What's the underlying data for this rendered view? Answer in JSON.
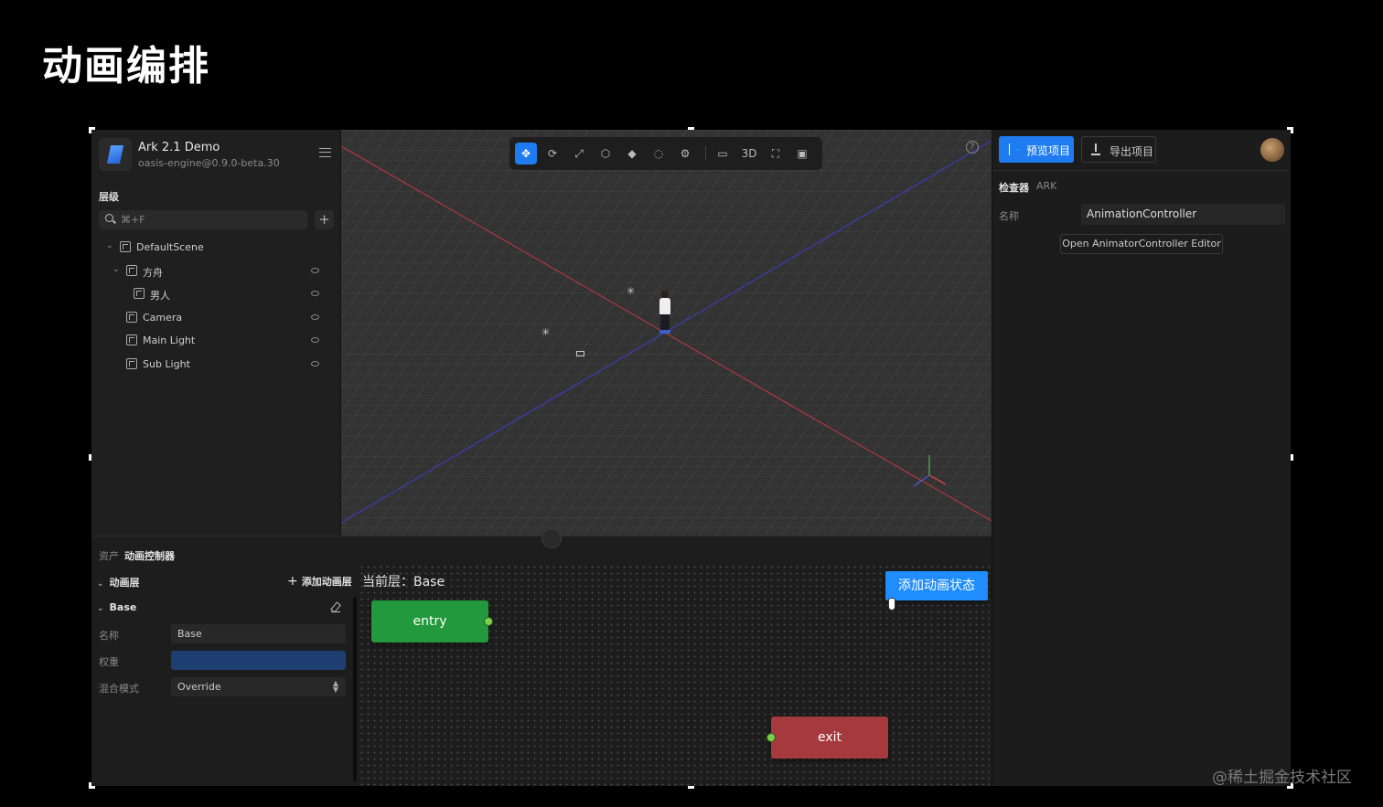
{
  "slide": {
    "title": "动画编排"
  },
  "app": {
    "name": "Ark 2.1 Demo",
    "version": "oasis-engine@0.9.0-beta.30"
  },
  "hierarchy": {
    "label": "层级",
    "search_placeholder": "⌘+F",
    "nodes": [
      {
        "label": "DefaultScene"
      },
      {
        "label": "方舟"
      },
      {
        "label": "男人"
      },
      {
        "label": "Camera"
      },
      {
        "label": "Main Light"
      },
      {
        "label": "Sub Light"
      }
    ]
  },
  "viewport": {
    "tools": [
      "move",
      "rotate",
      "scale",
      "mesh",
      "box",
      "circle",
      "settings",
      "camera",
      "3D",
      "fullscreen",
      "screenshot"
    ],
    "mode_label": "3D",
    "help_symbol": "?"
  },
  "inspector": {
    "preview_label": "预览项目",
    "export_label": "导出项目",
    "title": "检查器",
    "subtitle": "ARK",
    "name_label": "名称",
    "name_value": "AnimationController",
    "open_editor_label": "Open AnimatorController Editor"
  },
  "bottom": {
    "breadcrumb_root": "资产",
    "breadcrumb_current": "动画控制器",
    "layers_label": "动画层",
    "add_layer_label": "添加动画层",
    "layer_name": "Base",
    "props": {
      "name_label": "名称",
      "name_value": "Base",
      "weight_label": "权重",
      "blend_label": "混合模式",
      "blend_value": "Override"
    },
    "current_layer_label": "当前层：Base",
    "add_state_label": "添加动画状态",
    "nodes": {
      "entry": "entry",
      "exit": "exit"
    }
  },
  "watermark": "@稀土掘金技术社区",
  "colors": {
    "accent": "#1f7cf0",
    "entry": "#22993c",
    "exit": "#a5393d",
    "weight_bar": "#1e3e72"
  }
}
